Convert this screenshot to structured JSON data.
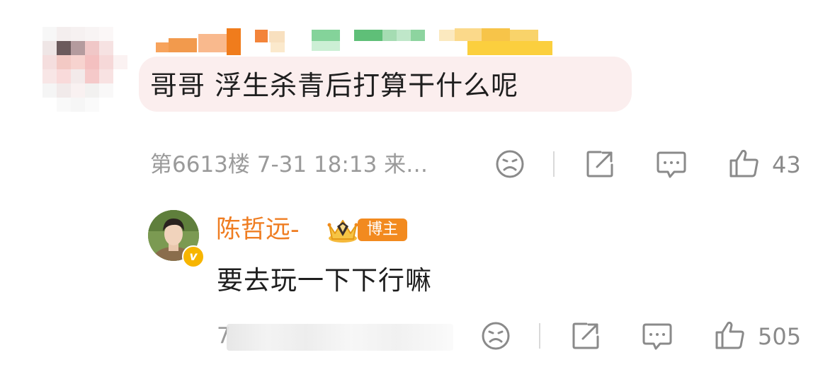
{
  "comment": {
    "text": "哥哥 浮生杀青后打算干什么呢",
    "meta": "第6613楼 7-31 18:13 来…",
    "like_count": "43"
  },
  "reply": {
    "author_name": "陈哲远-",
    "author_tag": "博主",
    "verified_badge": "v",
    "text": "要去玩一下下行嘛",
    "meta_visible": "7",
    "like_count": "505"
  },
  "icons": {
    "dislike": "sad-face-icon",
    "share": "share-icon",
    "reply": "comment-bubble-icon",
    "like": "thumbs-up-icon"
  },
  "colors": {
    "bubble_background": "#fbeeee",
    "author_name": "#ef7d22",
    "blogger_tag": "#f28a1f",
    "meta_text": "#9a9a9a",
    "icon": "#8a8a8a"
  }
}
